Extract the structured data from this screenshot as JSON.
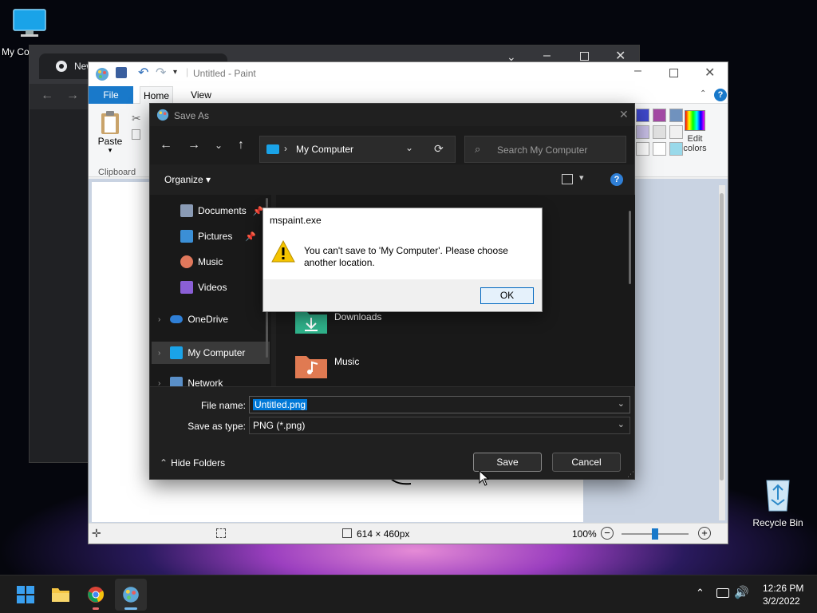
{
  "desktop": {
    "my_computer_label": "My Co",
    "recycle_bin_label": "Recycle Bin"
  },
  "chrome": {
    "tab_title": "New"
  },
  "paint": {
    "title": "Untitled - Paint",
    "tabs": {
      "file": "File",
      "home": "Home",
      "view": "View"
    },
    "ribbon": {
      "paste": "Paste",
      "clipboard": "Clipboard",
      "edit_colors_1": "Edit",
      "edit_colors_2": "colors"
    },
    "status": {
      "dimensions": "614 × 460px",
      "zoom": "100%"
    },
    "palette": [
      "#3f48cc",
      "#a349a4",
      "#7092be",
      "#c8bfe7",
      "#e0e0e0",
      "#f0f0f0",
      "#ffffff",
      "#ffffff",
      "#99d9ea"
    ]
  },
  "saveas": {
    "title": "Save As",
    "address": "My Computer",
    "search_placeholder": "Search My Computer",
    "organize": "Organize",
    "nav": {
      "documents": "Documents",
      "pictures": "Pictures",
      "music": "Music",
      "videos": "Videos",
      "onedrive": "OneDrive",
      "my_computer": "My Computer",
      "network": "Network"
    },
    "folders": {
      "downloads": "Downloads",
      "music": "Music"
    },
    "filename_label": "File name:",
    "filename_value": "Untitled.png",
    "type_label": "Save as type:",
    "type_value": "PNG (*.png)",
    "hide_folders": "Hide Folders",
    "save": "Save",
    "cancel": "Cancel"
  },
  "msgbox": {
    "title": "mspaint.exe",
    "line1": "You can't save to 'My Computer'. Please choose",
    "line2": "another location.",
    "ok": "OK"
  },
  "taskbar": {
    "time": "12:26 PM",
    "date": "3/2/2022"
  },
  "colors": {
    "accent": "#0067c0",
    "selection": "#0078d7",
    "warning": "#f5c400"
  }
}
